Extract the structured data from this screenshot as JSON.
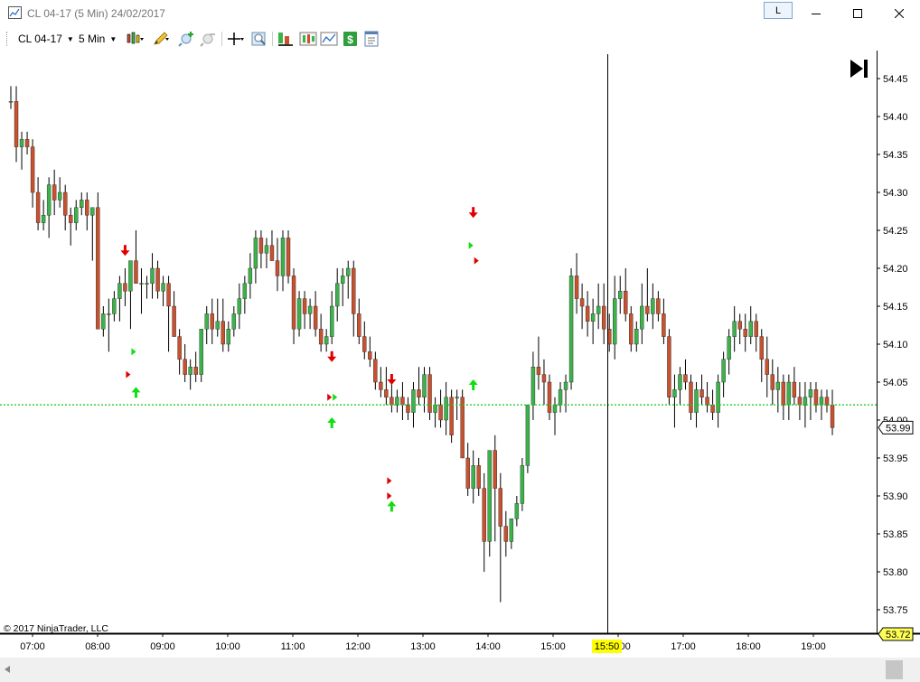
{
  "window": {
    "title": "CL 04-17 (5 Min)  24/02/2017",
    "link_label": "L",
    "minimize_icon": "minimize-icon",
    "maximize_icon": "maximize-icon",
    "close_icon": "close-icon"
  },
  "toolbar": {
    "instrument": "CL 04-17",
    "interval": "5 Min",
    "icons": [
      "bar-type-icon",
      "drawing-tools-icon",
      "zoom-in-icon",
      "zoom-out-icon",
      "crosshair-icon",
      "zoom-box-icon",
      "strategies-icon",
      "indicators-icon",
      "chart-style-icon",
      "price-markers-icon",
      "properties-icon"
    ]
  },
  "copyright": "© 2017 NinjaTrader, LLC",
  "colors": {
    "up_candle": "#3cb34a",
    "down_candle": "#c8512e",
    "wick": "#000000",
    "hline": "#22cc22",
    "buy_arrow": "#11dd11",
    "sell_arrow": "#e00000",
    "crosshair_time_bg": "#ffff00",
    "last_price_bg": "#ffff55"
  },
  "chart_data": {
    "type": "candlestick",
    "instrument": "CL 04-17",
    "interval": "5 Min",
    "ylim": [
      53.72,
      54.48
    ],
    "yticks": [
      "54.45",
      "54.40",
      "54.35",
      "54.30",
      "54.25",
      "54.20",
      "54.15",
      "54.10",
      "54.05",
      "54.00",
      "53.95",
      "53.90",
      "53.85",
      "53.80",
      "53.75"
    ],
    "xtick_labels": [
      "07:00",
      "08:00",
      "09:00",
      "10:00",
      "11:00",
      "12:00",
      "13:00",
      "14:00",
      "15:00",
      "16:00",
      "17:00",
      "18:00",
      "19:00"
    ],
    "horizontal_line": 54.02,
    "crosshair_time": "15:50",
    "last_price": "53.99",
    "bottom_price": "53.72",
    "candles": [
      [
        54.42,
        54.44,
        54.41,
        54.42
      ],
      [
        54.42,
        54.44,
        54.34,
        54.36
      ],
      [
        54.36,
        54.38,
        54.33,
        54.37
      ],
      [
        54.37,
        54.38,
        54.35,
        54.36
      ],
      [
        54.36,
        54.37,
        54.28,
        54.3
      ],
      [
        54.3,
        54.32,
        54.25,
        54.26
      ],
      [
        54.26,
        54.29,
        54.25,
        54.27
      ],
      [
        54.27,
        54.32,
        54.24,
        54.31
      ],
      [
        54.31,
        54.33,
        54.27,
        54.29
      ],
      [
        54.29,
        54.32,
        54.28,
        54.3
      ],
      [
        54.3,
        54.31,
        54.25,
        54.27
      ],
      [
        54.27,
        54.28,
        54.23,
        54.26
      ],
      [
        54.26,
        54.29,
        54.25,
        54.28
      ],
      [
        54.28,
        54.3,
        54.27,
        54.29
      ],
      [
        54.29,
        54.3,
        54.25,
        54.27
      ],
      [
        54.27,
        54.28,
        54.21,
        54.28
      ],
      [
        54.28,
        54.3,
        54.2,
        54.12
      ],
      [
        54.12,
        54.15,
        54.11,
        54.14
      ],
      [
        54.14,
        54.16,
        54.09,
        54.14
      ],
      [
        54.14,
        54.17,
        54.13,
        54.16
      ],
      [
        54.16,
        54.19,
        54.13,
        54.18
      ],
      [
        54.18,
        54.2,
        54.15,
        54.17
      ],
      [
        54.17,
        54.2,
        54.12,
        54.21
      ],
      [
        54.21,
        54.25,
        54.19,
        54.18
      ],
      [
        54.18,
        54.2,
        54.14,
        54.18
      ],
      [
        54.18,
        54.19,
        54.16,
        54.18
      ],
      [
        54.18,
        54.22,
        54.16,
        54.2
      ],
      [
        54.2,
        54.21,
        54.16,
        54.17
      ],
      [
        54.17,
        54.19,
        54.15,
        54.18
      ],
      [
        54.18,
        54.19,
        54.09,
        54.15
      ],
      [
        54.15,
        54.17,
        54.13,
        54.11
      ],
      [
        54.11,
        54.12,
        54.06,
        54.08
      ],
      [
        54.08,
        54.1,
        54.05,
        54.06
      ],
      [
        54.06,
        54.08,
        54.04,
        54.07
      ],
      [
        54.07,
        54.09,
        54.05,
        54.06
      ],
      [
        54.06,
        54.08,
        54.05,
        54.12
      ],
      [
        54.12,
        54.15,
        54.1,
        54.14
      ],
      [
        54.14,
        54.16,
        54.1,
        54.12
      ],
      [
        54.12,
        54.16,
        54.11,
        54.13
      ],
      [
        54.13,
        54.16,
        54.09,
        54.1
      ],
      [
        54.1,
        54.13,
        54.09,
        54.12
      ],
      [
        54.12,
        54.15,
        54.11,
        54.14
      ],
      [
        54.14,
        54.18,
        54.12,
        54.16
      ],
      [
        54.16,
        54.19,
        54.14,
        54.18
      ],
      [
        54.18,
        54.22,
        54.16,
        54.2
      ],
      [
        54.2,
        54.25,
        54.18,
        54.24
      ],
      [
        54.24,
        54.25,
        54.2,
        54.22
      ],
      [
        54.22,
        54.24,
        54.2,
        54.23
      ],
      [
        54.23,
        54.25,
        54.21,
        54.21
      ],
      [
        54.21,
        54.24,
        54.17,
        54.19
      ],
      [
        54.19,
        54.25,
        54.17,
        54.24
      ],
      [
        54.24,
        54.25,
        54.18,
        54.19
      ],
      [
        54.19,
        54.2,
        54.1,
        54.12
      ],
      [
        54.12,
        54.17,
        54.11,
        54.16
      ],
      [
        54.16,
        54.17,
        54.12,
        54.14
      ],
      [
        54.14,
        54.16,
        54.12,
        54.15
      ],
      [
        54.15,
        54.17,
        54.11,
        54.12
      ],
      [
        54.12,
        54.14,
        54.09,
        54.1
      ],
      [
        54.1,
        54.12,
        54.09,
        54.11
      ],
      [
        54.11,
        54.17,
        54.1,
        54.15
      ],
      [
        54.15,
        54.2,
        54.13,
        54.18
      ],
      [
        54.18,
        54.2,
        54.15,
        54.19
      ],
      [
        54.19,
        54.21,
        54.16,
        54.2
      ],
      [
        54.2,
        54.21,
        54.11,
        54.14
      ],
      [
        54.14,
        54.16,
        54.1,
        54.11
      ],
      [
        54.11,
        54.13,
        54.08,
        54.09
      ],
      [
        54.09,
        54.11,
        54.07,
        54.08
      ],
      [
        54.08,
        54.09,
        54.04,
        54.05
      ],
      [
        54.05,
        54.07,
        54.03,
        54.04
      ],
      [
        54.04,
        54.07,
        54.02,
        54.03
      ],
      [
        54.03,
        54.05,
        54.01,
        54.02
      ],
      [
        54.02,
        54.04,
        54.01,
        54.03
      ],
      [
        54.03,
        54.05,
        54.0,
        54.02
      ],
      [
        54.02,
        54.03,
        54.0,
        54.01
      ],
      [
        54.01,
        54.05,
        53.99,
        54.04
      ],
      [
        54.04,
        54.07,
        54.02,
        54.03
      ],
      [
        54.03,
        54.07,
        54.01,
        54.06
      ],
      [
        54.06,
        54.07,
        54.0,
        54.01
      ],
      [
        54.01,
        54.03,
        53.99,
        54.02
      ],
      [
        54.02,
        54.04,
        53.99,
        54.0
      ],
      [
        54.0,
        54.05,
        53.98,
        54.03
      ],
      [
        54.03,
        54.04,
        53.97,
        53.98
      ],
      [
        54.03,
        54.04,
        54.0,
        54.03
      ],
      [
        54.03,
        54.04,
        53.99,
        53.95
      ],
      [
        53.95,
        53.97,
        53.9,
        53.91
      ],
      [
        53.91,
        53.96,
        53.89,
        53.94
      ],
      [
        53.94,
        53.95,
        53.9,
        53.91
      ],
      [
        53.91,
        53.93,
        53.8,
        53.84
      ],
      [
        53.84,
        53.92,
        53.82,
        53.96
      ],
      [
        53.96,
        53.98,
        53.84,
        53.91
      ],
      [
        53.91,
        53.93,
        53.76,
        53.86
      ],
      [
        53.86,
        53.88,
        53.82,
        53.84
      ],
      [
        53.84,
        53.87,
        53.83,
        53.87
      ],
      [
        53.87,
        53.9,
        53.86,
        53.89
      ],
      [
        53.89,
        53.95,
        53.88,
        53.94
      ],
      [
        53.94,
        53.98,
        53.93,
        54.02
      ],
      [
        54.02,
        54.09,
        54.0,
        54.07
      ],
      [
        54.07,
        54.11,
        54.04,
        54.06
      ],
      [
        54.06,
        54.08,
        54.02,
        54.05
      ],
      [
        54.05,
        54.06,
        54.0,
        54.01
      ],
      [
        54.01,
        54.03,
        53.98,
        54.02
      ],
      [
        54.02,
        54.05,
        54.01,
        54.04
      ],
      [
        54.04,
        54.06,
        54.01,
        54.05
      ],
      [
        54.05,
        54.2,
        54.04,
        54.19
      ],
      [
        54.19,
        54.22,
        54.14,
        54.16
      ],
      [
        54.16,
        54.18,
        54.12,
        54.15
      ],
      [
        54.15,
        54.17,
        54.11,
        54.13
      ],
      [
        54.13,
        54.16,
        54.1,
        54.14
      ],
      [
        54.14,
        54.18,
        54.12,
        54.15
      ],
      [
        54.15,
        54.18,
        54.1,
        54.12
      ],
      [
        54.12,
        54.14,
        54.09,
        54.1
      ],
      [
        54.1,
        54.19,
        54.08,
        54.16
      ],
      [
        54.16,
        54.19,
        54.14,
        54.17
      ],
      [
        54.17,
        54.2,
        54.13,
        54.14
      ],
      [
        54.14,
        54.15,
        54.09,
        54.1
      ],
      [
        54.1,
        54.13,
        54.09,
        54.12
      ],
      [
        54.12,
        54.18,
        54.1,
        54.15
      ],
      [
        54.15,
        54.2,
        54.13,
        54.14
      ],
      [
        54.14,
        54.18,
        54.12,
        54.16
      ],
      [
        54.16,
        54.17,
        54.13,
        54.14
      ],
      [
        54.14,
        54.16,
        54.1,
        54.11
      ],
      [
        54.11,
        54.12,
        54.02,
        54.03
      ],
      [
        54.03,
        54.06,
        53.99,
        54.04
      ],
      [
        54.04,
        54.07,
        54.02,
        54.06
      ],
      [
        54.06,
        54.08,
        54.04,
        54.05
      ],
      [
        54.05,
        54.06,
        54.0,
        54.01
      ],
      [
        54.01,
        54.05,
        53.99,
        54.04
      ],
      [
        54.04,
        54.06,
        54.02,
        54.03
      ],
      [
        54.03,
        54.05,
        54.01,
        54.02
      ],
      [
        54.02,
        54.04,
        54.0,
        54.01
      ],
      [
        54.01,
        54.06,
        53.99,
        54.05
      ],
      [
        54.05,
        54.09,
        54.03,
        54.08
      ],
      [
        54.08,
        54.12,
        54.06,
        54.11
      ],
      [
        54.11,
        54.15,
        54.09,
        54.13
      ],
      [
        54.13,
        54.14,
        54.1,
        54.12
      ],
      [
        54.12,
        54.14,
        54.09,
        54.11
      ],
      [
        54.11,
        54.15,
        54.1,
        54.13
      ],
      [
        54.13,
        54.14,
        54.09,
        54.11
      ],
      [
        54.11,
        54.12,
        54.05,
        54.08
      ],
      [
        54.08,
        54.11,
        54.03,
        54.06
      ],
      [
        54.06,
        54.08,
        54.02,
        54.04
      ],
      [
        54.04,
        54.07,
        54.01,
        54.05
      ],
      [
        54.05,
        54.06,
        54.0,
        54.02
      ],
      [
        54.02,
        54.06,
        54.0,
        54.05
      ],
      [
        54.05,
        54.07,
        54.02,
        54.03
      ],
      [
        54.03,
        54.05,
        54.0,
        54.02
      ],
      [
        54.02,
        54.05,
        53.99,
        54.03
      ],
      [
        54.03,
        54.05,
        54.0,
        54.04
      ],
      [
        54.04,
        54.05,
        54.01,
        54.02
      ],
      [
        54.02,
        54.04,
        54.0,
        54.03
      ],
      [
        54.03,
        54.04,
        54.01,
        54.02
      ],
      [
        54.02,
        54.04,
        53.98,
        53.99
      ]
    ],
    "markers": [
      {
        "i": 21,
        "type": "sell",
        "price": 54.22
      },
      {
        "i": 23,
        "type": "buy",
        "price": 54.04
      },
      {
        "i": 22,
        "type": "tri_red",
        "price": 54.06
      },
      {
        "i": 23,
        "type": "tri_green",
        "price": 54.09
      },
      {
        "i": 59,
        "type": "sell",
        "price": 54.08
      },
      {
        "i": 59,
        "type": "buy",
        "price": 54.0
      },
      {
        "i": 59,
        "type": "tri_red",
        "price": 54.03
      },
      {
        "i": 60,
        "type": "tri_green",
        "price": 54.03
      },
      {
        "i": 70,
        "type": "sell",
        "price": 54.05
      },
      {
        "i": 70,
        "type": "buy",
        "price": 53.89
      },
      {
        "i": 70,
        "type": "tri_red",
        "price": 53.92
      },
      {
        "i": 70,
        "type": "tri_red",
        "price": 53.9
      },
      {
        "i": 85,
        "type": "sell",
        "price": 54.27
      },
      {
        "i": 85,
        "type": "buy",
        "price": 54.05
      },
      {
        "i": 85,
        "type": "tri_green",
        "price": 54.23
      },
      {
        "i": 86,
        "type": "tri_red",
        "price": 54.21
      }
    ]
  }
}
